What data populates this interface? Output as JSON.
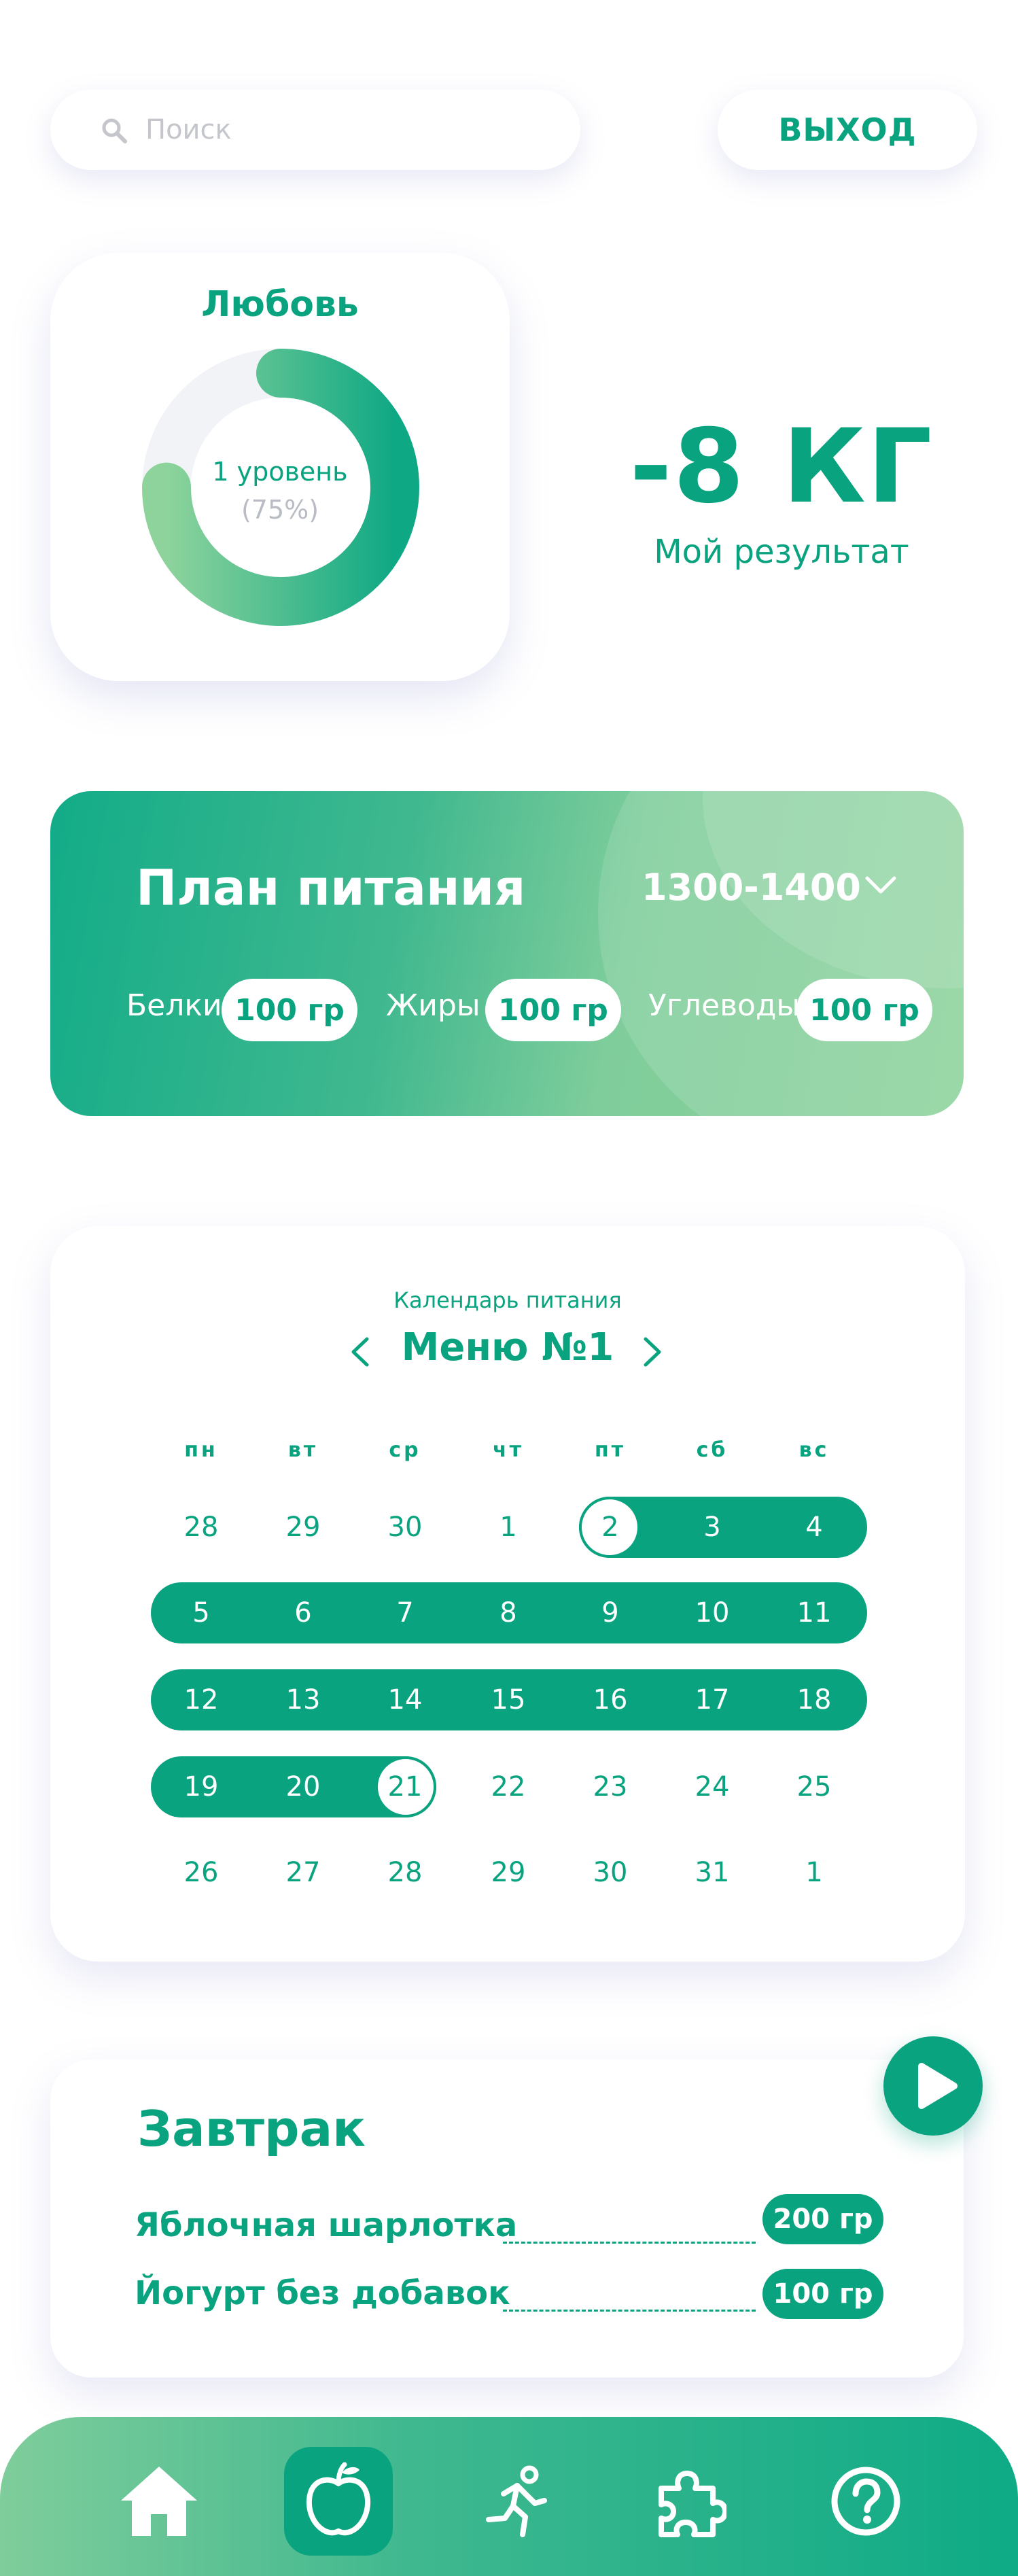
{
  "search": {
    "placeholder": "Поиск"
  },
  "header": {
    "logout_label": "ВЫХОД"
  },
  "level_card": {
    "title": "Любовь",
    "level_text": "1 уровень",
    "percent_text": "(75%)",
    "progress": 0.75
  },
  "result": {
    "value": "-8 КГ",
    "label": "Мой результат"
  },
  "plan": {
    "title": "План питания",
    "range": "1300-1400",
    "macros": [
      {
        "label": "Белки",
        "value": "100 гр"
      },
      {
        "label": "Жиры",
        "value": "100 гр"
      },
      {
        "label": "Углеводы",
        "value": "100 гр"
      }
    ]
  },
  "calendar": {
    "caption": "Календарь питания",
    "title": "Меню №1",
    "weekdays": [
      "пн",
      "вт",
      "ср",
      "чт",
      "пт",
      "сб",
      "вс"
    ],
    "weeks": [
      [
        "28",
        "29",
        "30",
        "1",
        "2",
        "3",
        "4"
      ],
      [
        "5",
        "6",
        "7",
        "8",
        "9",
        "10",
        "11"
      ],
      [
        "12",
        "13",
        "14",
        "15",
        "16",
        "17",
        "18"
      ],
      [
        "19",
        "20",
        "21",
        "22",
        "23",
        "24",
        "25"
      ],
      [
        "26",
        "27",
        "28",
        "29",
        "30",
        "31",
        "1"
      ]
    ],
    "range_start": "2",
    "range_end": "21"
  },
  "breakfast": {
    "title": "Завтрак",
    "items": [
      {
        "name": "Яблочная шарлотка",
        "amount": "200 гр"
      },
      {
        "name": "Йогурт без добавок",
        "amount": "100 гр"
      }
    ]
  },
  "nav": {
    "items": [
      "home-icon",
      "apple-icon",
      "running-icon",
      "puzzle-icon",
      "help-icon"
    ],
    "active": "apple-icon"
  },
  "colors": {
    "accent": "#0aa37f",
    "light_accent": "#8ed39c",
    "muted": "#b9bcc4"
  }
}
